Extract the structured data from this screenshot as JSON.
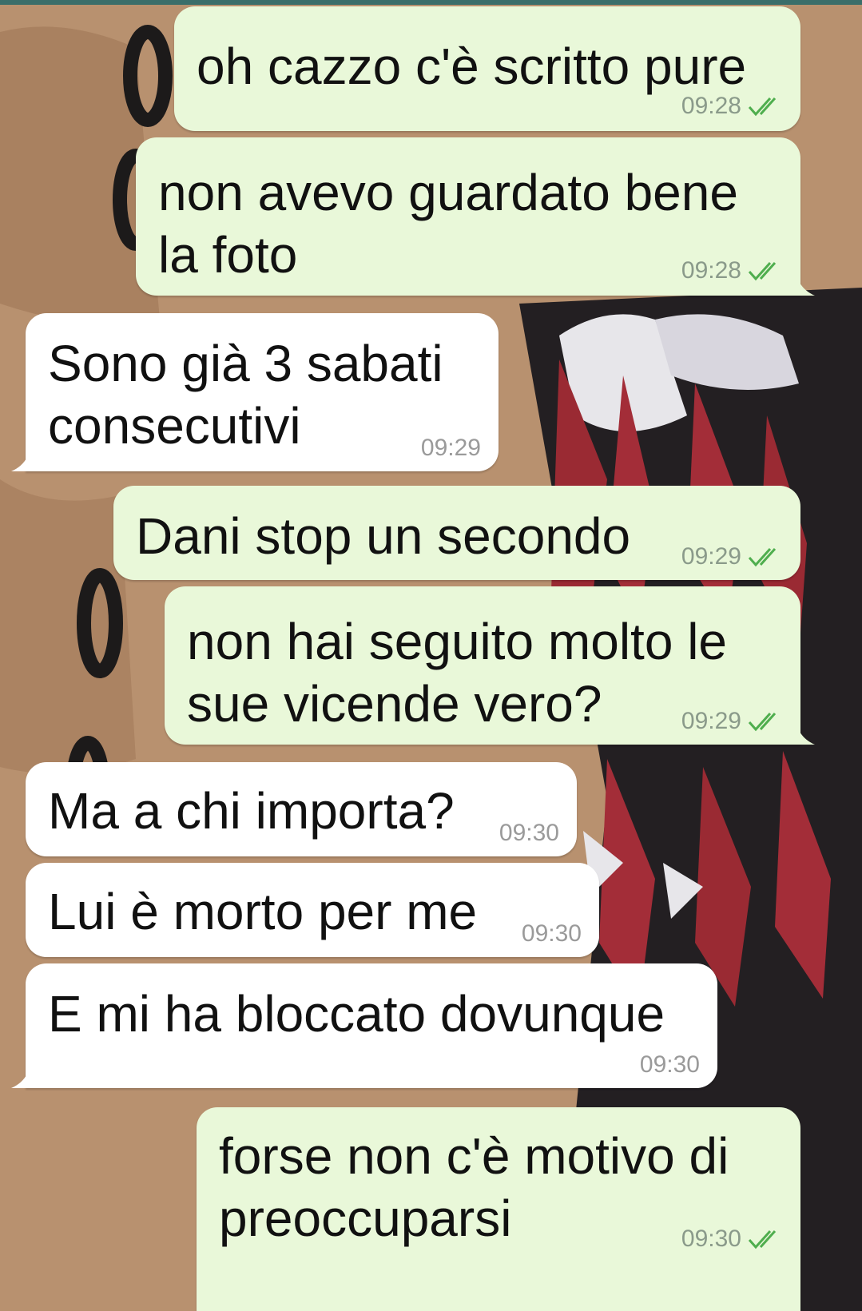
{
  "chat": {
    "messages": [
      {
        "direction": "out",
        "lines": [
          "oh cazzo c'è scritto pure"
        ],
        "time": "09:28",
        "status": "read-double-check"
      },
      {
        "direction": "out",
        "lines": [
          "non avevo guardato bene",
          "la foto"
        ],
        "time": "09:28",
        "status": "read-double-check"
      },
      {
        "direction": "in",
        "lines": [
          "Sono già 3 sabati",
          "consecutivi"
        ],
        "time": "09:29"
      },
      {
        "direction": "out",
        "lines": [
          "Dani stop un secondo"
        ],
        "time": "09:29",
        "status": "read-double-check"
      },
      {
        "direction": "out",
        "lines": [
          "non hai seguito molto le",
          "sue vicende vero?"
        ],
        "time": "09:29",
        "status": "read-double-check"
      },
      {
        "direction": "in",
        "lines": [
          "Ma a chi importa?"
        ],
        "time": "09:30"
      },
      {
        "direction": "in",
        "lines": [
          "Lui è morto per me"
        ],
        "time": "09:30"
      },
      {
        "direction": "in",
        "lines": [
          "E mi ha bloccato dovunque"
        ],
        "time": "09:30"
      },
      {
        "direction": "out",
        "lines": [
          "forse non c'è motivo di",
          "preoccuparsi"
        ],
        "time": "09:30",
        "status": "read-double-check"
      }
    ]
  },
  "colors": {
    "outgoing_bubble": "#e9f8d9",
    "incoming_bubble": "#ffffff",
    "read_tick": "#4fae4e",
    "timestamp": "#8a9a8a"
  },
  "icons": {
    "read_receipt": "double-check-icon"
  }
}
